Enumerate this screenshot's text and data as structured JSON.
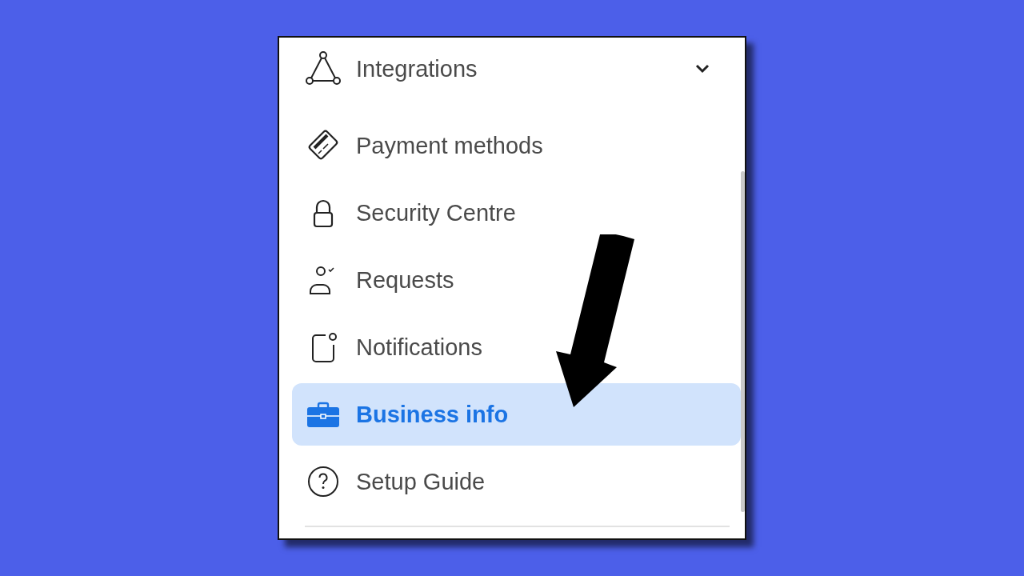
{
  "menu": {
    "section": {
      "label": "Integrations",
      "expanded": false
    },
    "items": [
      {
        "label": "Payment methods",
        "selected": false
      },
      {
        "label": "Security Centre",
        "selected": false
      },
      {
        "label": "Requests",
        "selected": false
      },
      {
        "label": "Notifications",
        "selected": false
      },
      {
        "label": "Business info",
        "selected": true
      },
      {
        "label": "Setup Guide",
        "selected": false
      }
    ]
  }
}
